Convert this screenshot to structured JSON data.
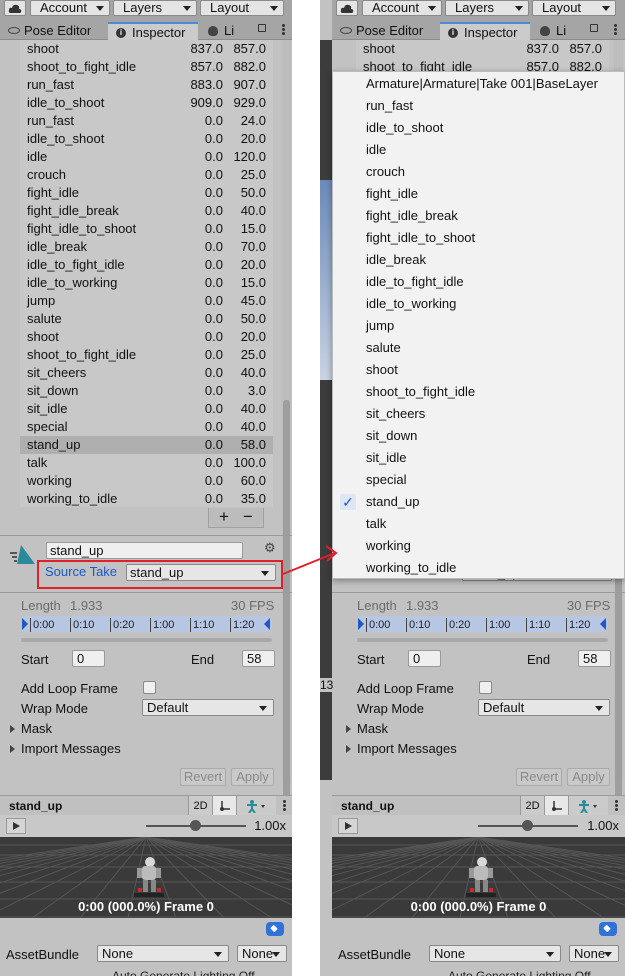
{
  "toolbar": {
    "account_label": "Account",
    "layers_label": "Layers",
    "layout_label": "Layout"
  },
  "tabs": {
    "pose_editor": "Pose Editor",
    "inspector": "Inspector",
    "lighting_partial": "Li"
  },
  "clips": [
    {
      "name": "shoot",
      "start": "837.0",
      "end": "857.0"
    },
    {
      "name": "shoot_to_fight_idle",
      "start": "857.0",
      "end": "882.0"
    },
    {
      "name": "run_fast",
      "start": "883.0",
      "end": "907.0"
    },
    {
      "name": "idle_to_shoot",
      "start": "909.0",
      "end": "929.0"
    },
    {
      "name": "run_fast",
      "start": "0.0",
      "end": "24.0"
    },
    {
      "name": "idle_to_shoot",
      "start": "0.0",
      "end": "20.0"
    },
    {
      "name": "idle",
      "start": "0.0",
      "end": "120.0"
    },
    {
      "name": "crouch",
      "start": "0.0",
      "end": "25.0"
    },
    {
      "name": "fight_idle",
      "start": "0.0",
      "end": "50.0"
    },
    {
      "name": "fight_idle_break",
      "start": "0.0",
      "end": "40.0"
    },
    {
      "name": "fight_idle_to_shoot",
      "start": "0.0",
      "end": "15.0"
    },
    {
      "name": "idle_break",
      "start": "0.0",
      "end": "70.0"
    },
    {
      "name": "idle_to_fight_idle",
      "start": "0.0",
      "end": "20.0"
    },
    {
      "name": "idle_to_working",
      "start": "0.0",
      "end": "15.0"
    },
    {
      "name": "jump",
      "start": "0.0",
      "end": "45.0"
    },
    {
      "name": "salute",
      "start": "0.0",
      "end": "50.0"
    },
    {
      "name": "shoot",
      "start": "0.0",
      "end": "20.0"
    },
    {
      "name": "shoot_to_fight_idle",
      "start": "0.0",
      "end": "25.0"
    },
    {
      "name": "sit_cheers",
      "start": "0.0",
      "end": "40.0"
    },
    {
      "name": "sit_down",
      "start": "0.0",
      "end": "3.0"
    },
    {
      "name": "sit_idle",
      "start": "0.0",
      "end": "40.0"
    },
    {
      "name": "special",
      "start": "0.0",
      "end": "40.0"
    },
    {
      "name": "stand_up",
      "start": "0.0",
      "end": "58.0"
    },
    {
      "name": "talk",
      "start": "0.0",
      "end": "100.0"
    },
    {
      "name": "working",
      "start": "0.0",
      "end": "60.0"
    },
    {
      "name": "working_to_idle",
      "start": "0.0",
      "end": "35.0"
    }
  ],
  "selected_clip_index": 22,
  "list_buttons": {
    "add": "+",
    "remove": "−"
  },
  "clip_settings": {
    "name_value": "stand_up",
    "source_take_label": "Source Take",
    "source_take_value": "stand_up",
    "length_label": "Length",
    "length_value": "1.933",
    "fps_label": "30 FPS",
    "timeline_ticks": [
      "0:00",
      "0:10",
      "0:20",
      "1:00",
      "1:10",
      "1:20"
    ],
    "start_label": "Start",
    "start_value": "0",
    "end_label": "End",
    "end_value": "58",
    "add_loop_frame_label": "Add Loop Frame",
    "wrap_mode_label": "Wrap Mode",
    "wrap_mode_value": "Default",
    "mask_label": "Mask",
    "import_messages_label": "Import Messages",
    "revert_label": "Revert",
    "apply_label": "Apply"
  },
  "preview": {
    "title": "stand_up",
    "mode_2d": "2D",
    "speed": "1.00x",
    "frame_label": "0:00 (000.0%) Frame 0"
  },
  "asset_bundle": {
    "label": "AssetBundle",
    "name_value": "None",
    "variant_value": "None",
    "cut_text": "Auto Generate Lighting Off"
  },
  "side_number": "13",
  "popup_items": [
    "Armature|Armature|Take 001|BaseLayer",
    "run_fast",
    "idle_to_shoot",
    "idle",
    "crouch",
    "fight_idle",
    "fight_idle_break",
    "fight_idle_to_shoot",
    "idle_break",
    "idle_to_fight_idle",
    "idle_to_working",
    "jump",
    "salute",
    "shoot",
    "shoot_to_fight_idle",
    "sit_cheers",
    "sit_down",
    "sit_idle",
    "special",
    "stand_up",
    "talk",
    "working",
    "working_to_idle"
  ],
  "popup_checked_index": 19,
  "check_mark": "✓",
  "colors": {
    "accent_blue": "#1f57c8",
    "highlight_red": "#e0202a",
    "selection_gray": "#afafaf"
  }
}
